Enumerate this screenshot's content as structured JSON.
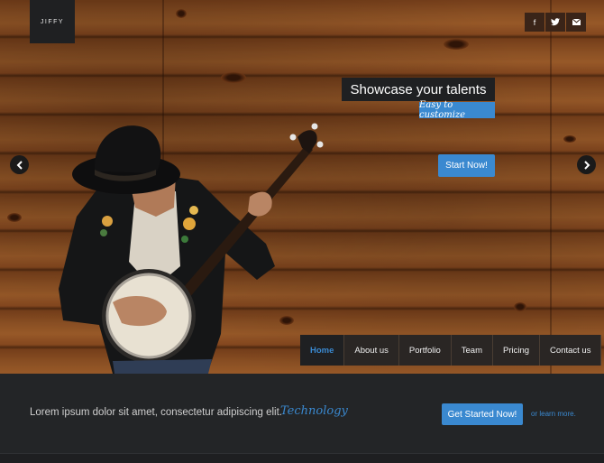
{
  "header": {
    "logo": "JIFFY",
    "social": [
      "f",
      "t",
      "mail"
    ]
  },
  "hero": {
    "tagline": "Showcase your talents",
    "subtag": "Easy to customize",
    "cta": "Start Now!",
    "prev_icon": "chevron-left-icon",
    "next_icon": "chevron-right-icon"
  },
  "nav": {
    "items": [
      "Home",
      "About us",
      "Portfolio",
      "Team",
      "Pricing",
      "Contact us"
    ],
    "active": "Home"
  },
  "band": {
    "text": "Lorem ipsum dolor sit amet, consectetur adipiscing elit.",
    "script": "Technology",
    "cta": "Get Started Now!",
    "learn": "or learn more."
  },
  "colors": {
    "accent": "#3a89d0",
    "dark": "#232527",
    "wood": "#a35e2a"
  }
}
